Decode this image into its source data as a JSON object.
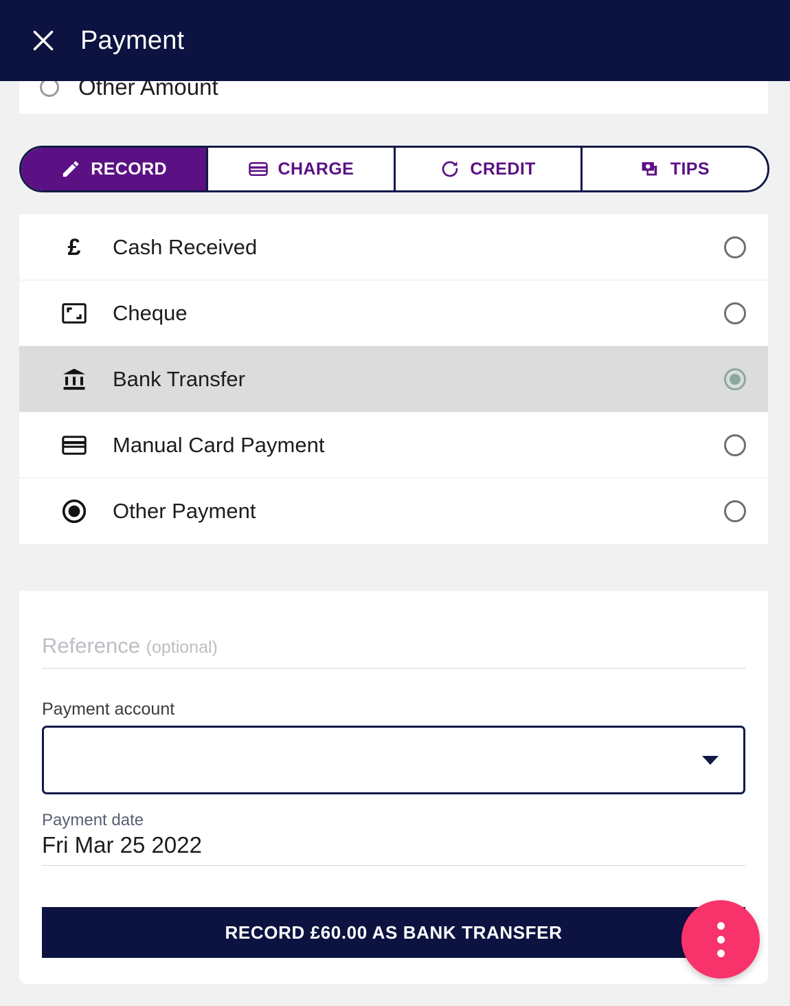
{
  "header": {
    "title": "Payment",
    "close_icon": "close-icon",
    "background": "#0c1340"
  },
  "amount_section": {
    "visible_option": "Other Amount",
    "selected": false
  },
  "tabs": [
    {
      "label": "RECORD",
      "icon": "pencil-icon",
      "active": true
    },
    {
      "label": "CHARGE",
      "icon": "credit-card-icon",
      "active": false
    },
    {
      "label": "CREDIT",
      "icon": "refresh-icon",
      "active": false
    },
    {
      "label": "TIPS",
      "icon": "banknotes-icon",
      "active": false
    }
  ],
  "payment_methods": [
    {
      "label": "Cash Received",
      "icon": "pound-sign-icon",
      "selected": false
    },
    {
      "label": "Cheque",
      "icon": "cheque-icon",
      "selected": false
    },
    {
      "label": "Bank Transfer",
      "icon": "bank-icon",
      "selected": true
    },
    {
      "label": "Manual Card Payment",
      "icon": "credit-card-icon",
      "selected": false
    },
    {
      "label": "Other Payment",
      "icon": "filled-radio-icon",
      "selected": false
    }
  ],
  "form": {
    "reference": {
      "value": "",
      "placeholder_main": "Reference",
      "placeholder_optional": "(optional)"
    },
    "payment_account": {
      "label": "Payment account",
      "value": ""
    },
    "payment_date": {
      "label": "Payment date",
      "value": "Fri Mar 25 2022"
    },
    "submit_label": "RECORD £60.00 AS BANK TRANSFER"
  },
  "fab": {
    "icon": "more-vertical-icon",
    "color": "#f8336b"
  },
  "colors": {
    "navy": "#0c1340",
    "purple": "#5b1184",
    "pink": "#f8336b",
    "selected_row": "#dcdcdc",
    "selected_radio": "#8aa99b"
  }
}
